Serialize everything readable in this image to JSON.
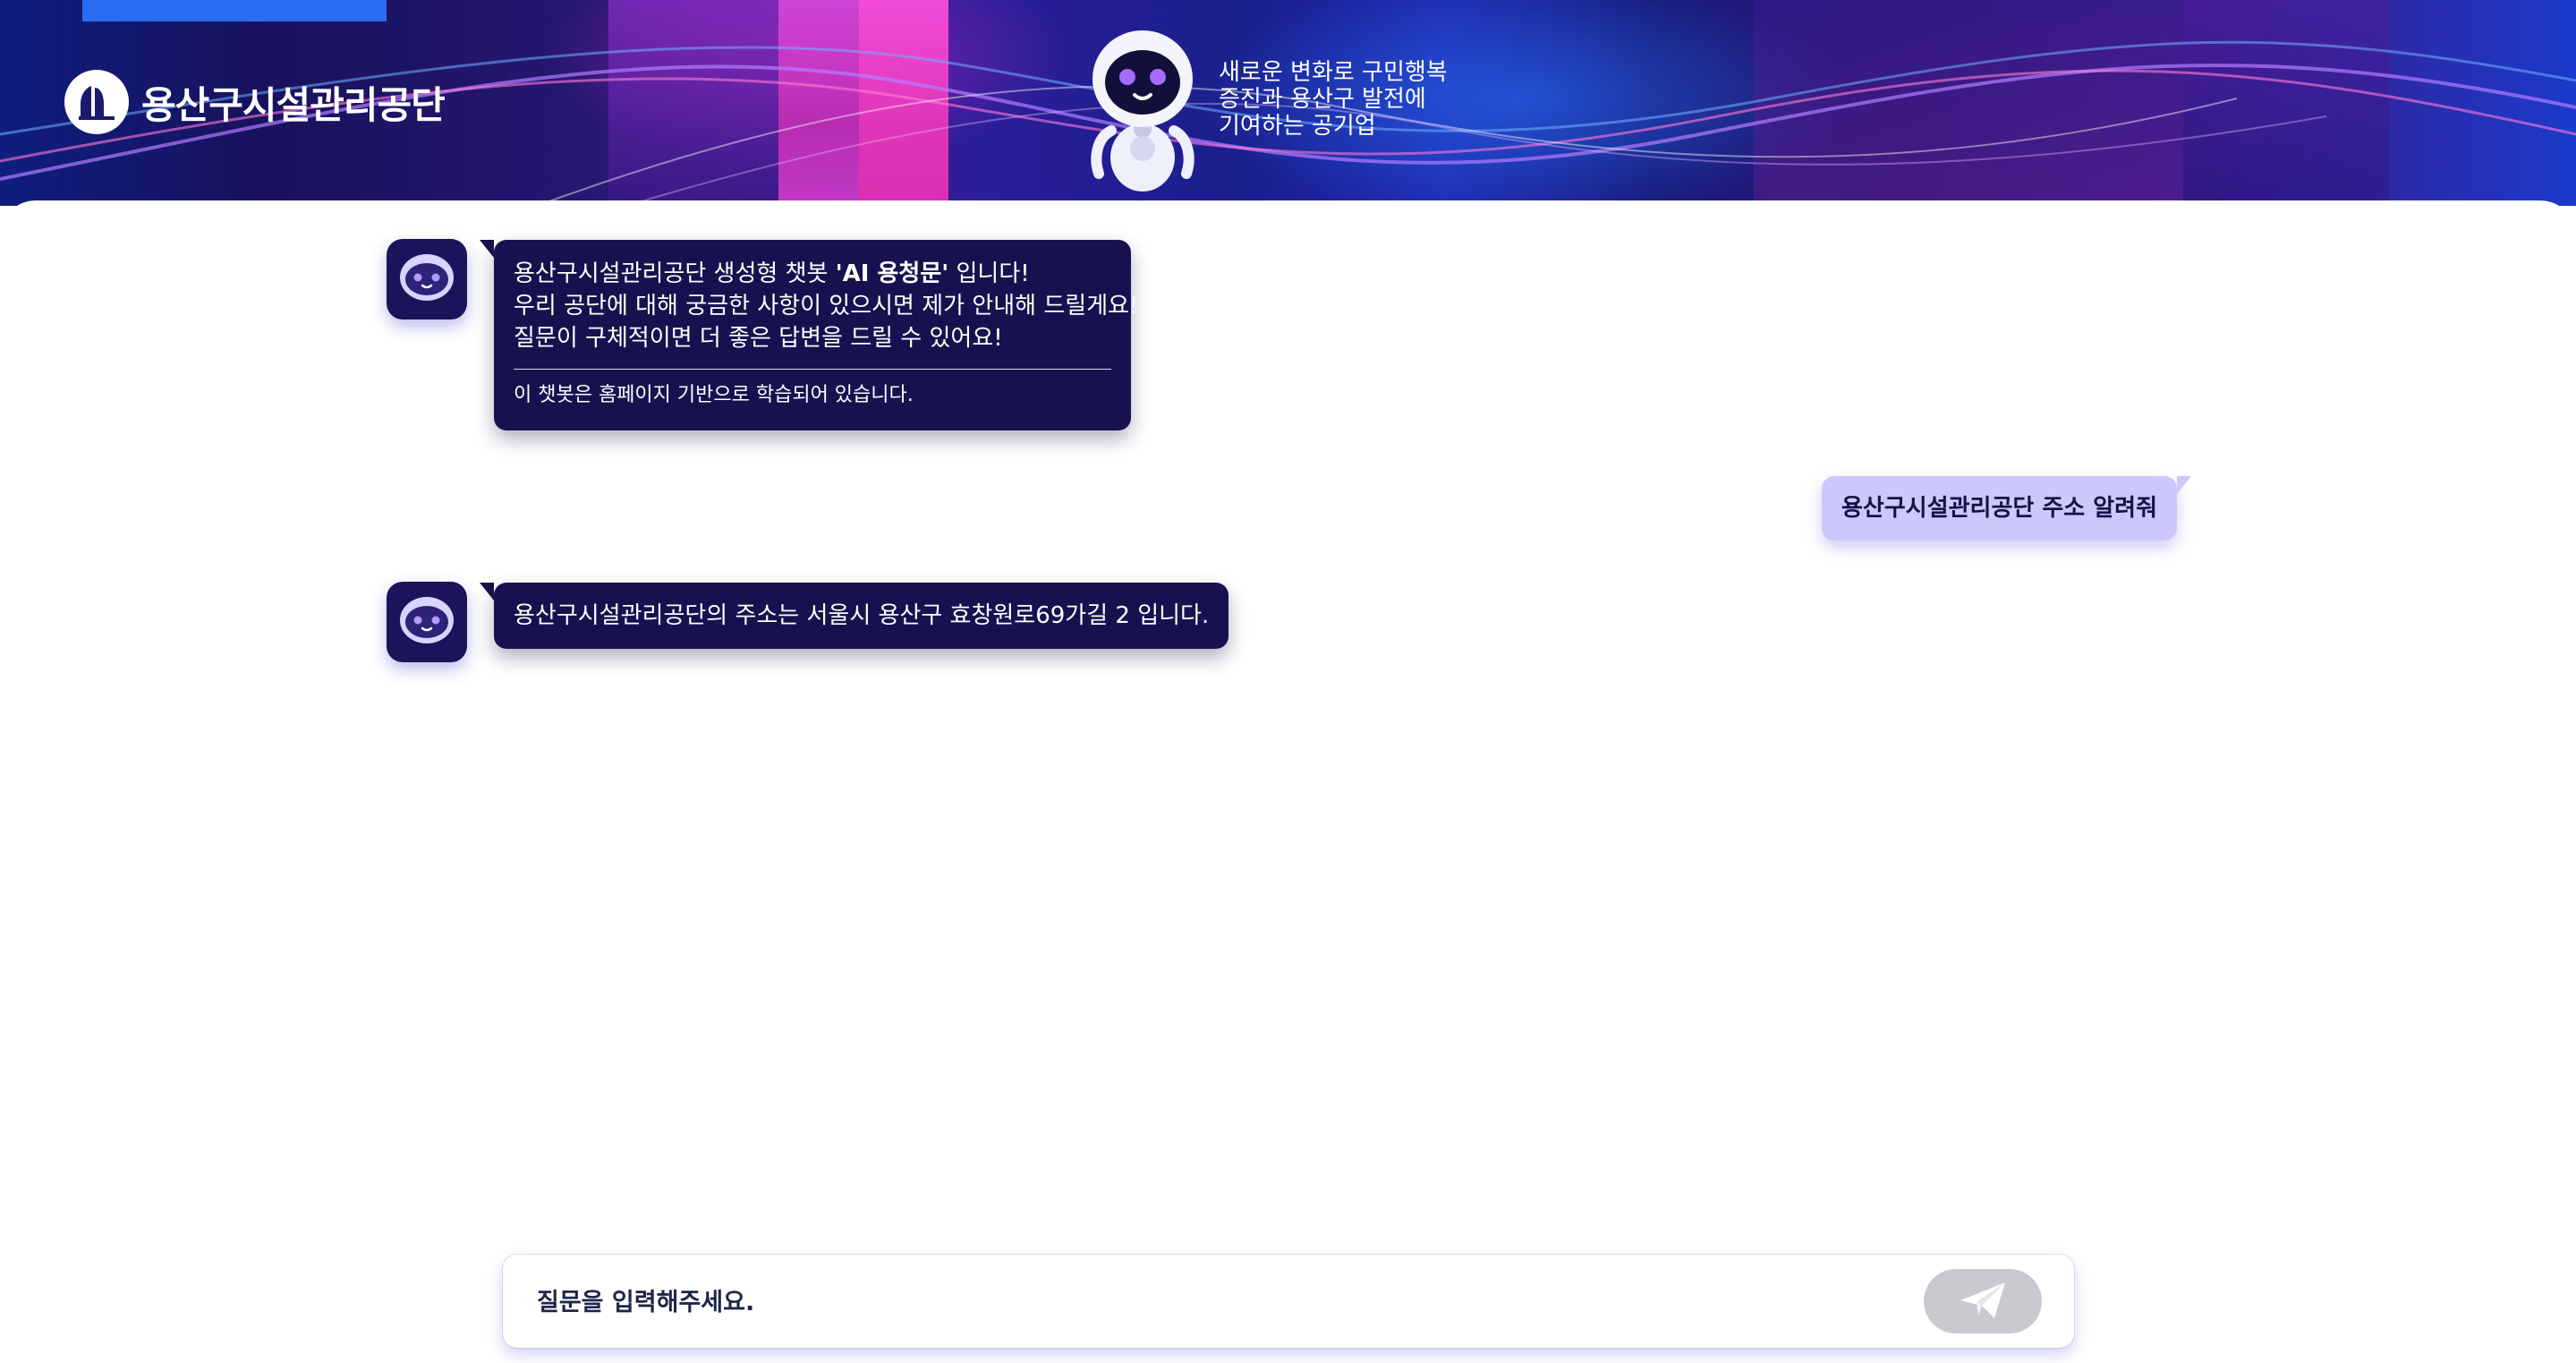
{
  "header": {
    "logo_text": "용산구시설관리공단",
    "slogan_lines": [
      "새로운 변화로 구민행복",
      "증진과 용산구 발전에",
      "기여하는 공기업"
    ]
  },
  "messages": [
    {
      "role": "bot",
      "lines": [
        {
          "pre": "용산구시설관리공단 생성형 챗봇 ",
          "bold": "'AI 용청문'",
          "post": " 입니다!"
        },
        {
          "text": "우리 공단에 대해 궁금한 사항이 있으시면 제가 안내해 드릴게요!"
        },
        {
          "text": "질문이 구체적이면 더 좋은 답변을 드릴 수 있어요!"
        }
      ],
      "note": "이 챗봇은 홈페이지 기반으로 학습되어 있습니다."
    },
    {
      "role": "user",
      "text": "용산구시설관리공단 주소 알려줘"
    },
    {
      "role": "bot",
      "text": "용산구시설관리공단의 주소는 서울시 용산구 효창원로69가길 2 입니다."
    }
  ],
  "input": {
    "placeholder": "질문을 입력해주세요.",
    "value": ""
  },
  "icons": {
    "send": "paper-plane-icon",
    "avatar": "chatbot-face-icon",
    "logo": "yongsan-logo-icon",
    "mascot": "robot-mascot-icon"
  },
  "colors": {
    "bot_bubble": "#17124f",
    "user_bubble": "#cdc8fb",
    "send_button": "#c9c9cf",
    "header_accent": "#e23fd0"
  }
}
